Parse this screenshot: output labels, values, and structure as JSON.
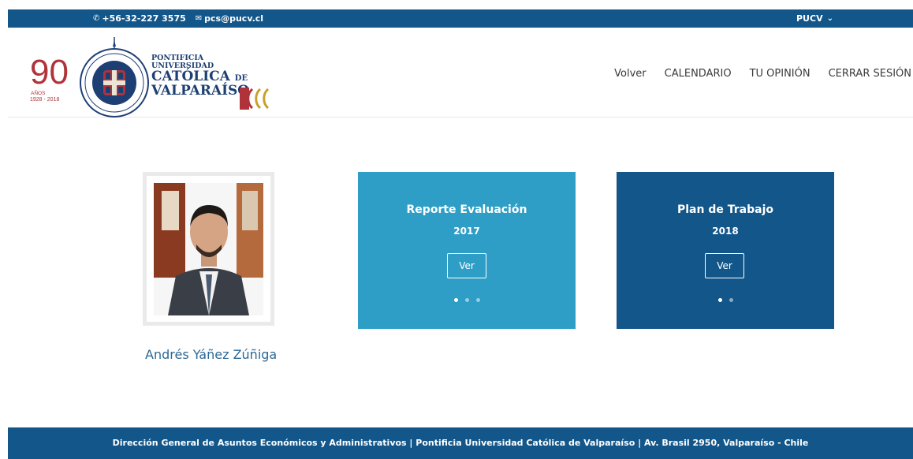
{
  "topbar": {
    "phone": "+56-32-227 3575",
    "email": "pcs@pucv.cl",
    "menu_label": "PUCV"
  },
  "logo": {
    "number": "90",
    "anos": "AÑOS",
    "years": "1928 - 2018",
    "uni_line1": "PONTIFICIA",
    "uni_line2": "UNIVERSIDAD",
    "uni_line3": "CATÓLICA",
    "uni_de": "DE",
    "uni_line4": "VALPARAÍSO"
  },
  "nav": {
    "items": [
      "Volver",
      "CALENDARIO",
      "TU OPINIÓN",
      "CERRAR SESIÓN"
    ]
  },
  "profile": {
    "name": "Andrés Yáñez Zúñiga"
  },
  "cards": [
    {
      "title": "Reporte Evaluación",
      "year": "2017",
      "button": "Ver",
      "dots": 3,
      "active_dot": 0,
      "color": "#2e9ec6"
    },
    {
      "title": "Plan de Trabajo",
      "year": "2018",
      "button": "Ver",
      "dots": 2,
      "active_dot": 0,
      "color": "#135689"
    }
  ],
  "footer": {
    "text": "Dirección General de Asuntos Económicos y Administrativos | Pontificia Universidad Católica de Valparaíso | Av. Brasil 2950, Valparaíso - Chile"
  },
  "colors": {
    "primary": "#135689",
    "accent": "#2e9ec6",
    "logo_red": "#b0333a"
  }
}
